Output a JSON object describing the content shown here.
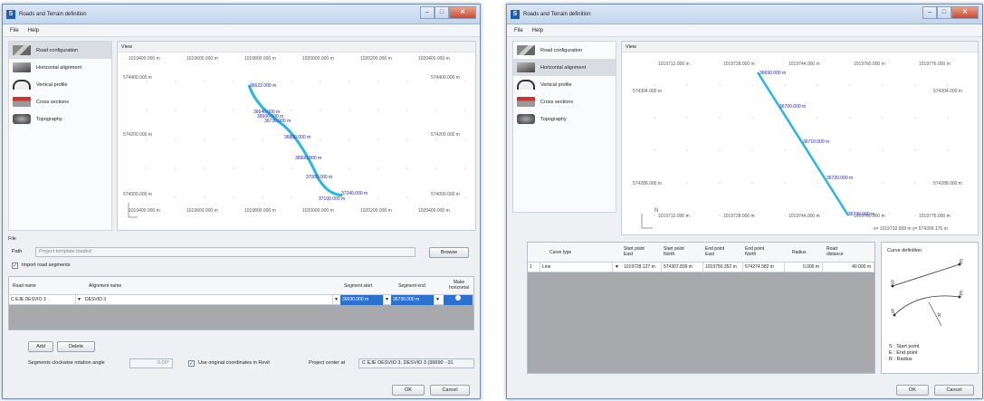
{
  "window_title": "Roads and Terrain definition",
  "menu": [
    "File",
    "Help"
  ],
  "nav_items": [
    "Road configuration",
    "Horizontal alignment",
    "Vertical profile",
    "Cross sections",
    "Topography"
  ],
  "view_label": "View",
  "left": {
    "x_ticks": [
      "1019400.000 m",
      "1019600.000 m",
      "1019800.000 m",
      "1020000.000 m",
      "1020200.000 m",
      "1020400.000 m"
    ],
    "x_ticks_bottom": [
      "1019400.000 m",
      "1019600.000 m",
      "1019800.000 m",
      "1020000.000 m",
      "1020200.000 m",
      "1020400.000 m"
    ],
    "y_ticks_left": [
      "574400.000 m",
      "574200.000 m",
      "574000.000 m"
    ],
    "y_ticks_right": [
      "574400.000 m",
      "574200.000 m",
      "574000.000 m"
    ],
    "stations": [
      "36622.000 m",
      "36640.000 m",
      "36600.000 m",
      "36730.000 m",
      "36800.000 m",
      "36900.000 m",
      "37000.000 m",
      "37100.000 m",
      "37240.000 m"
    ],
    "file_section": "File",
    "path_label": "Path",
    "path_value": "Project template loaded",
    "browse": "Browse",
    "import_label": "Import road segments",
    "col_road": "Road name",
    "col_alignment": "Alignment name",
    "col_seg_start": "Segment start",
    "col_seg_end": "Segment end",
    "col_make": "Make horizontal",
    "row_road": "C EJE DESVIO 3",
    "row_alignment": "DESVIO 3",
    "row_start": "36690.000 m",
    "row_end": "36730.000 m",
    "add": "Add",
    "delete": "Delete",
    "rot_label": "Segments clockwise rotation angle",
    "rot_value": "0.00°",
    "orig_label": "Use original coordinates in Revit",
    "proj_label": "Project center at",
    "proj_value": "C EJE DESVIO 3, DESVIO 3 (36690 - 31",
    "ok": "OK",
    "cancel": "Cancel"
  },
  "right": {
    "x_ticks": [
      "1019712.000 m",
      "1019728.000 m",
      "1019744.000 m",
      "1019760.000 m",
      "1019776.000 m"
    ],
    "x_ticks_bottom": [
      "1019712.000 m",
      "1019728.000 m",
      "1019744.000 m",
      "1019760.000 m",
      "1019776.000 m"
    ],
    "y_ticks_left": [
      "574304.000 m",
      "574288.000 m"
    ],
    "y_ticks_right": [
      "574304.000 m",
      "574288.000 m"
    ],
    "stations": [
      "36690.000 m",
      "36700.000 m",
      "36710.000 m",
      "36720.000 m",
      "36730.000 m"
    ],
    "coord_readout": "x= 1019732.669 m   y= 574306.176 m",
    "headers": [
      "Curve type",
      "Start point East",
      "Start point North",
      "End point East",
      "End point North",
      "Radius",
      "Road distance"
    ],
    "row": [
      "1",
      "Line",
      "1019728.127 m",
      "574307.839 m",
      "1019750.352 m",
      "574274.582 m",
      "0.000 m",
      "40.000 m"
    ],
    "curve_title": "Curve definition",
    "legend": [
      "S : Start point",
      "E : End point",
      "R : Radius"
    ],
    "ok": "OK",
    "cancel": "Cancel"
  }
}
